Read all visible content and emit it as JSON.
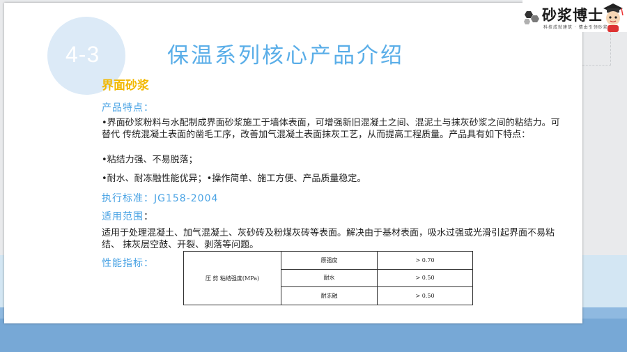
{
  "slide": {
    "section_number": "4-3",
    "title": "保温系列核心产品介绍",
    "product_name": "界面砂浆",
    "features_heading": "产品特点：",
    "features_intro": "•界面砂浆粉料与水配制成界面砂浆施工于墙体表面，可增强新旧混凝土之间、混泥土与抹灰砂浆之间的粘结力。可替代 传统混凝土表面的凿毛工序，改善加气混凝土表面抹灰工艺，从而提高工程质量。产品具有如下特点：",
    "feature_1": "•粘结力强、不易脱落；",
    "feature_2": "•耐水、耐冻融性能优异；•操作简单、施工方便、产品质量稳定。",
    "standard_label": "执行标准：JG158-2004",
    "scope_heading": "适用范围",
    "scope_colon": "：",
    "scope_text": "适用于处理混凝土、加气混凝土、灰砂砖及粉煤灰砖等表面。解决由于基材表面，吸水过强或光滑引起界面不易粘结、 抹灰层空鼓、开裂、剥落等问题。",
    "performance_heading": "性能指标："
  },
  "spec_table": {
    "row_header": "压 剪 粘结强度(MPa)",
    "rows": [
      {
        "condition": "原强度",
        "value": "> 0.70"
      },
      {
        "condition": "耐水",
        "value": "> 0.50"
      },
      {
        "condition": "耐冻融",
        "value": "> 0.50"
      }
    ]
  },
  "brand": {
    "name": "砂浆博士",
    "slogan": "科技成就建筑 · 情由引领砂浆"
  },
  "colors": {
    "title_blue": "#5aaee8",
    "product_yellow": "#f2b800",
    "band_light": "#d3e6f3",
    "band_dark": "#77a8d6"
  }
}
